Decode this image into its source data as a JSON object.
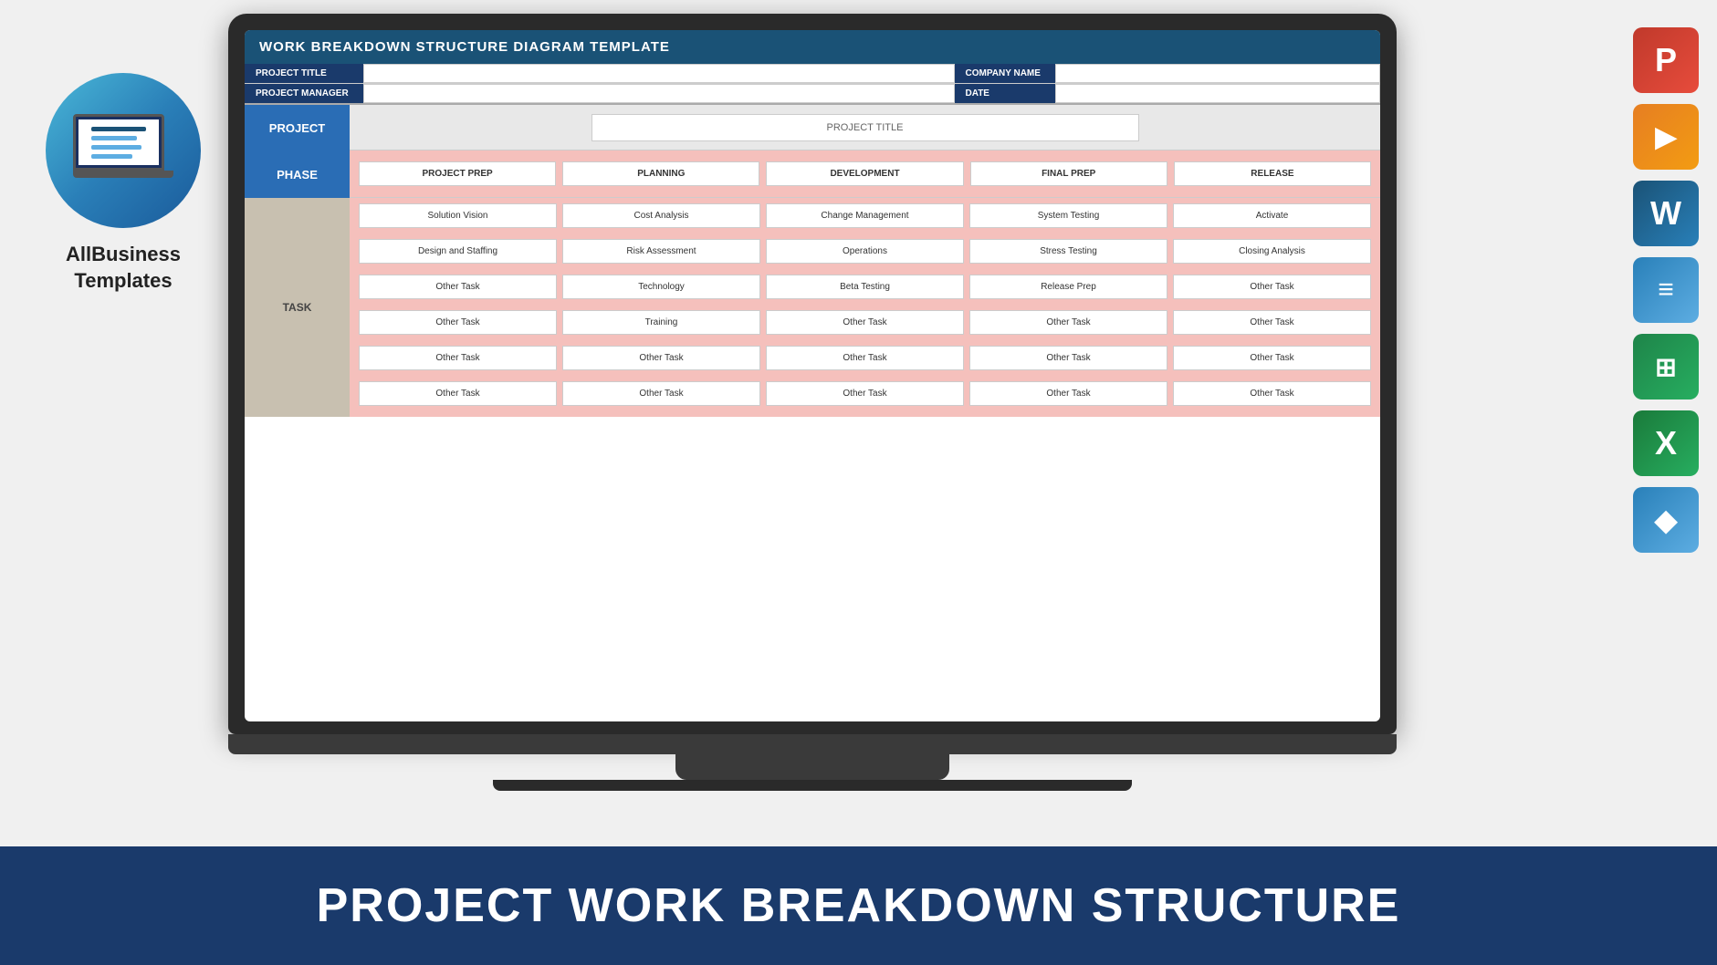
{
  "page": {
    "background_color": "#f0f0f0"
  },
  "logo": {
    "brand_name": "AllBusiness",
    "brand_name2": "Templates"
  },
  "bottom_banner": {
    "text": "PROJECT WORK BREAKDOWN STRUCTURE"
  },
  "wbs": {
    "title": "WORK BREAKDOWN STRUCTURE DIAGRAM TEMPLATE",
    "fields": {
      "project_title_label": "PROJECT TITLE",
      "project_manager_label": "PROJECT MANAGER",
      "company_name_label": "COMPANY NAME",
      "date_label": "DATE"
    },
    "section_labels": {
      "project": "PROJECT",
      "phase": "PHASE",
      "task": "TASK"
    },
    "project_title_placeholder": "PROJECT TITLE",
    "phases": [
      "PROJECT PREP",
      "PLANNING",
      "DEVELOPMENT",
      "FINAL PREP",
      "RELEASE"
    ],
    "task_rows": [
      [
        "Solution Vision",
        "Cost Analysis",
        "Change Management",
        "System Testing",
        "Activate"
      ],
      [
        "Design and Staffing",
        "Risk Assessment",
        "Operations",
        "Stress Testing",
        "Closing Analysis"
      ],
      [
        "Other Task",
        "Technology",
        "Beta Testing",
        "Release Prep",
        "Other Task"
      ],
      [
        "Other Task",
        "Training",
        "Other Task",
        "Other Task",
        "Other Task"
      ],
      [
        "Other Task",
        "Other Task",
        "Other Task",
        "Other Task",
        "Other Task"
      ],
      [
        "Other Task",
        "Other Task",
        "Other Task",
        "Other Task",
        "Other Task"
      ]
    ]
  },
  "right_icons": [
    {
      "label": "P",
      "class": "icon-powerpoint",
      "name": "powerpoint-icon"
    },
    {
      "label": "▶",
      "class": "icon-slides",
      "name": "slides-icon"
    },
    {
      "label": "W",
      "class": "icon-word",
      "name": "word-icon"
    },
    {
      "label": "≡",
      "class": "icon-docs",
      "name": "docs-icon"
    },
    {
      "label": "⊞",
      "class": "icon-sheets",
      "name": "sheets-icon"
    },
    {
      "label": "X",
      "class": "icon-excel",
      "name": "excel-icon"
    },
    {
      "label": "◆",
      "class": "icon-dropbox",
      "name": "dropbox-icon"
    }
  ]
}
